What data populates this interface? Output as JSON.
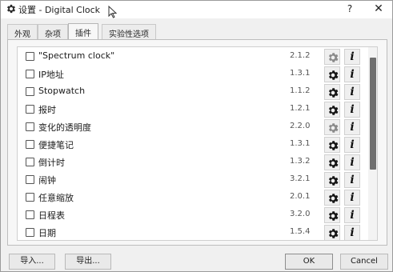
{
  "window": {
    "title": "设置 - Digital Clock",
    "help_label": "?",
    "close_label": "✕"
  },
  "tabs": [
    {
      "label": "外观"
    },
    {
      "label": "杂项"
    },
    {
      "label": "插件"
    },
    {
      "label": "实验性选项"
    }
  ],
  "active_tab": "插件",
  "plugins": [
    {
      "name": "\"Spectrum clock\"",
      "version": "2.1.2",
      "checked": false,
      "settings_enabled": false
    },
    {
      "name": "IP地址",
      "version": "1.3.1",
      "checked": false,
      "settings_enabled": true
    },
    {
      "name": "Stopwatch",
      "version": "1.1.2",
      "checked": false,
      "settings_enabled": true
    },
    {
      "name": "报时",
      "version": "1.2.1",
      "checked": false,
      "settings_enabled": true
    },
    {
      "name": "变化的透明度",
      "version": "2.2.0",
      "checked": false,
      "settings_enabled": false
    },
    {
      "name": "便捷笔记",
      "version": "1.3.1",
      "checked": false,
      "settings_enabled": true
    },
    {
      "name": "倒计时",
      "version": "1.3.2",
      "checked": false,
      "settings_enabled": true
    },
    {
      "name": "闹钟",
      "version": "3.2.1",
      "checked": false,
      "settings_enabled": true
    },
    {
      "name": "任意缩放",
      "version": "2.0.1",
      "checked": false,
      "settings_enabled": true
    },
    {
      "name": "日程表",
      "version": "3.2.0",
      "checked": false,
      "settings_enabled": true
    },
    {
      "name": "日期",
      "version": "1.5.4",
      "checked": false,
      "settings_enabled": true
    }
  ],
  "info_label": "i",
  "buttons": {
    "import": "导入...",
    "export": "导出...",
    "ok": "OK",
    "cancel": "Cancel"
  }
}
